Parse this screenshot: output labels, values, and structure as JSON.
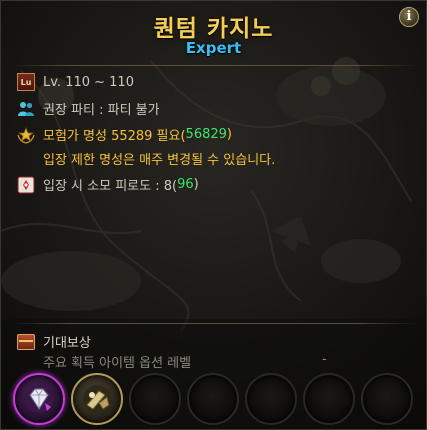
{
  "header": {
    "title": "퀀텀 카지노",
    "difficulty": "Expert",
    "info_icon": "i"
  },
  "requirements": {
    "level_icon_text": "Lu",
    "level_text": "Lv. 110 ~ 110",
    "party_text": "권장 파티 : 파티 불가",
    "fame_prefix": "모험가 명성 55289 필요(",
    "fame_current": "56829",
    "fame_suffix": ")",
    "fame_notice": "입장 제한 명성은 매주 변경될 수 있습니다.",
    "fatigue_prefix": "입장 시 소모 피로도 : 8(",
    "fatigue_current": "96",
    "fatigue_suffix": ")"
  },
  "reward": {
    "header": "기대보상",
    "subline": "주요 획득 아이템 옵션 레벨",
    "dash": "-",
    "slots": [
      {
        "icon": "purple-gem-icon",
        "filled": true
      },
      {
        "icon": "gold-equipment-icon",
        "filled": true
      },
      {
        "icon": "empty-slot",
        "filled": false
      },
      {
        "icon": "empty-slot",
        "filled": false
      },
      {
        "icon": "empty-slot",
        "filled": false
      },
      {
        "icon": "empty-slot",
        "filled": false
      },
      {
        "icon": "empty-slot",
        "filled": false
      }
    ]
  },
  "colors": {
    "title": "#f2cf5a",
    "difficulty": "#39bff5",
    "warning": "#f5c23a",
    "ok": "#3ee46c"
  }
}
